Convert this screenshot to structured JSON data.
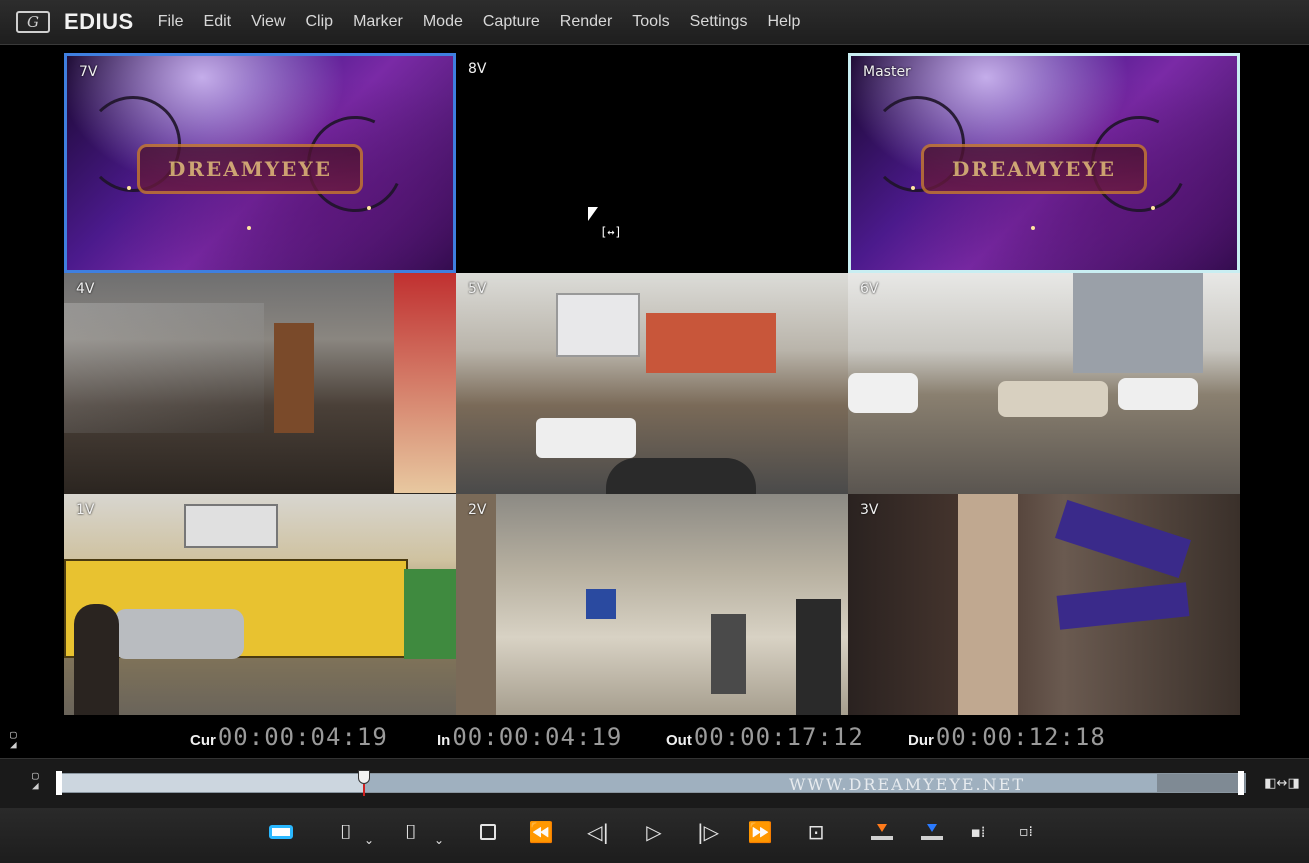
{
  "app": {
    "logo_text": "G",
    "name": "EDIUS"
  },
  "menu": [
    "File",
    "Edit",
    "View",
    "Clip",
    "Marker",
    "Mode",
    "Capture",
    "Render",
    "Tools",
    "Settings",
    "Help"
  ],
  "viewer": {
    "cells": [
      {
        "label": "7V",
        "kind": "title"
      },
      {
        "label": "8V",
        "kind": "empty"
      },
      {
        "label": "Master",
        "kind": "title"
      },
      {
        "label": "4V",
        "kind": "mall"
      },
      {
        "label": "5V",
        "kind": "street"
      },
      {
        "label": "6V",
        "kind": "park"
      },
      {
        "label": "1V",
        "kind": "bus"
      },
      {
        "label": "2V",
        "kind": "concourse"
      },
      {
        "label": "3V",
        "kind": "shop"
      }
    ],
    "title_card_text": "DREAMYEYE",
    "selected_source": "7V",
    "program_output": "Master"
  },
  "timecodes": {
    "cur_label": "Cur",
    "cur_value": "00:00:04:19",
    "in_label": "In",
    "in_value": "00:00:04:19",
    "out_label": "Out",
    "out_value": "00:00:17:12",
    "dur_label": "Dur",
    "dur_value": "00:00:12:18"
  },
  "scrubber": {
    "watermark": "WWW.DREAMYEYE.NET",
    "playhead_position": 0.257,
    "in_point": 0.257,
    "out_point": 0.926
  },
  "transport": {
    "icons": [
      "playback-mode-icon",
      "set-in-icon",
      "in-dropdown-icon",
      "set-out-icon",
      "out-dropdown-icon",
      "stop-icon",
      "rewind-icon",
      "step-back-icon",
      "play-icon",
      "step-forward-icon",
      "fast-forward-icon",
      "loop-icon",
      "insert-to-timeline-icon",
      "overwrite-to-timeline-icon",
      "add-multicam-icon",
      "sync-multicam-icon"
    ]
  },
  "colors": {
    "selected_border": "#3f7fe0",
    "master_border": "#c9eef2",
    "timecode_value": "#9a9a9a",
    "insert_accent": "#ff7a1a",
    "overwrite_accent": "#2a7aff"
  }
}
